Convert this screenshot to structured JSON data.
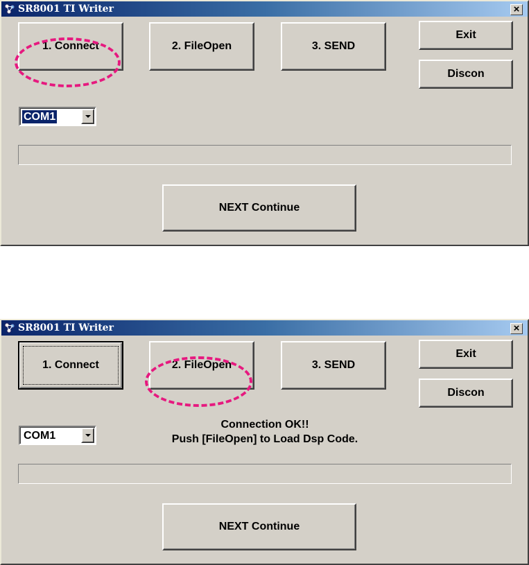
{
  "windows": [
    {
      "title": "SR8001 TI Writer",
      "close_label": "×",
      "buttons": {
        "connect": "1. Connect",
        "file_open": "2. FileOpen",
        "send": "3. SEND",
        "exit": "Exit",
        "discon": "Discon",
        "next": "NEXT Continue"
      },
      "com_port": "COM1",
      "status_lines": []
    },
    {
      "title": "SR8001 TI Writer",
      "close_label": "×",
      "buttons": {
        "connect": "1. Connect",
        "file_open": "2. FileOpen",
        "send": "3. SEND",
        "exit": "Exit",
        "discon": "Discon",
        "next": "NEXT Continue"
      },
      "com_port": "COM1",
      "status_lines": [
        "Connection OK!!",
        "Push [FileOpen] to Load Dsp Code."
      ]
    }
  ],
  "colors": {
    "titlebar": "#0a246a",
    "window_face": "#d4d0c8",
    "highlight": "#e6197f"
  },
  "icons": [
    "app-icon",
    "close-icon",
    "dropdown-arrow-icon"
  ]
}
